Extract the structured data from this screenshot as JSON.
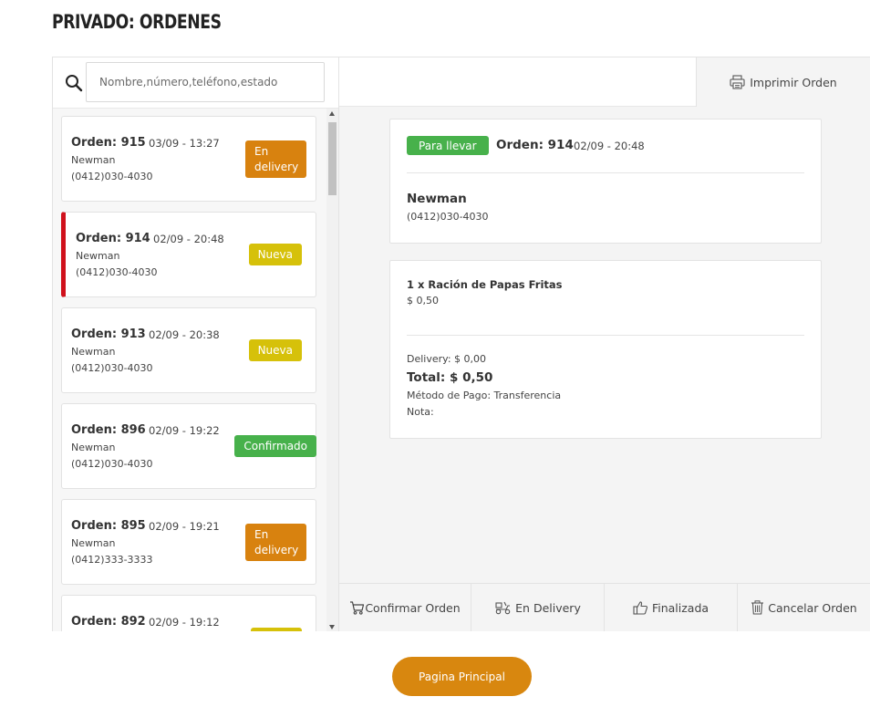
{
  "page": {
    "title": "PRIVADO: ORDENES"
  },
  "search": {
    "placeholder": "Nombre,número,teléfono,estado",
    "value": "",
    "icon": "search-icon"
  },
  "orders": [
    {
      "number": "Orden: 915",
      "date": "03/09 - 13:27",
      "name": "Newman",
      "phone": "(0412)030-4030",
      "status": "En delivery"
    },
    {
      "number": "Orden: 914",
      "date": "02/09 - 20:48",
      "name": "Newman",
      "phone": "(0412)030-4030",
      "status": "Nueva"
    },
    {
      "number": "Orden: 913",
      "date": "02/09 - 20:38",
      "name": "Newman",
      "phone": "(0412)030-4030",
      "status": "Nueva"
    },
    {
      "number": "Orden: 896",
      "date": "02/09 - 19:22",
      "name": "Newman",
      "phone": "(0412)030-4030",
      "status": "Confirmado"
    },
    {
      "number": "Orden: 895",
      "date": "02/09 - 19:21",
      "name": "Newman",
      "phone": "(0412)333-3333",
      "status": "En delivery"
    },
    {
      "number": "Orden: 892",
      "date": "02/09 - 19:12",
      "name": "",
      "phone": "",
      "status": ""
    }
  ],
  "toolbar": {
    "print_label": "Imprimir Orden",
    "print_icon": "printer-icon"
  },
  "detail": {
    "type_label": "Para llevar",
    "number": "Orden: 914",
    "date": "02/09 - 20:48",
    "customer_name": "Newman",
    "customer_phone": "(0412)030-4030",
    "item": "1 x Ración de Papas Fritas",
    "item_price": "$ 0,50",
    "delivery": "Delivery: $ 0,00",
    "total": "Total: $ 0,50",
    "payment": "Método de Pago: Transferencia",
    "note": "Nota:"
  },
  "actions": {
    "confirm": "Confirmar Orden",
    "delivery": "En Delivery",
    "finish": "Finalizada",
    "cancel": "Cancelar Orden"
  },
  "footer": {
    "home_label": "Pagina Principal"
  },
  "colors": {
    "delivery": "#d8820f",
    "nueva": "#d6c10a",
    "confirmado": "#47b14b",
    "selected": "#d0111c",
    "home_button": "#d8870f"
  }
}
